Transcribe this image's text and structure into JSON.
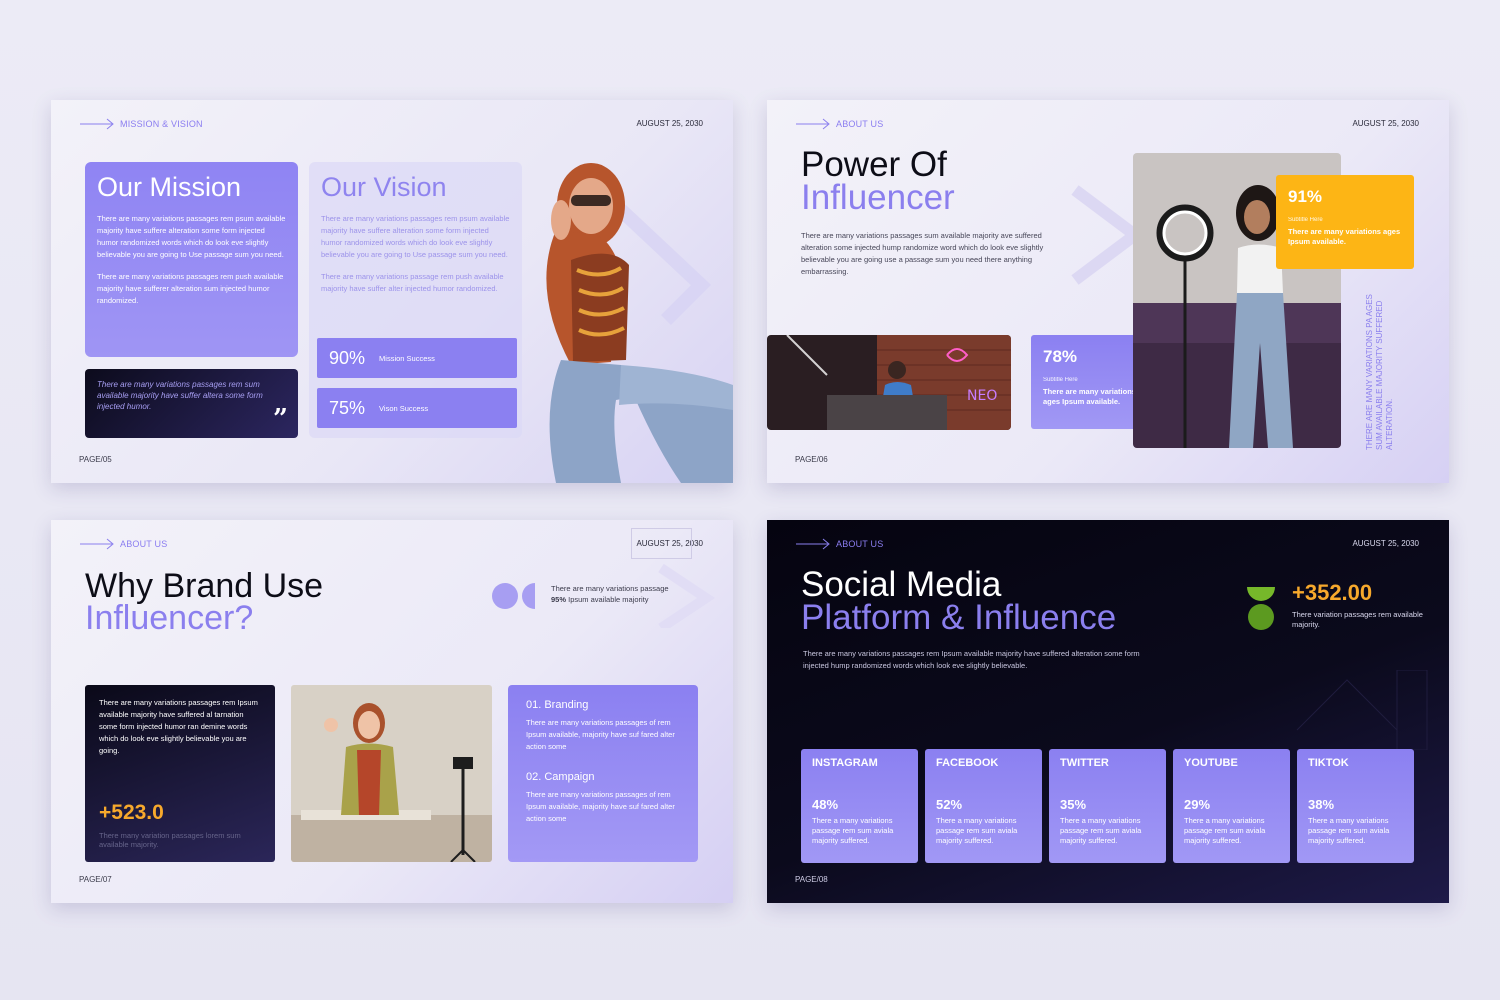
{
  "colors": {
    "accent": "#8b7fee",
    "orange": "#f7a92c",
    "dark": "#0b0a1c",
    "green": "#76b82a"
  },
  "slide1": {
    "tag": "MISSION & VISION",
    "date": "AUGUST 25, 2030",
    "mission_title": "Our Mission",
    "mission_p1": "There are many variations passages rem psum available majority have suffere alteration some form injected humor randomized words which do look eve slightly believable you are going to Use passage sum you need.",
    "mission_p2": "There are many variations passages rem push available majority have sufferer alteration sum injected humor randomized.",
    "vision_title": "Our Vision",
    "vision_p1": "There are many variations passages rem psum available majority have suffere alteration some form injected humor randomized words which do look eve slightly believable you are going to Use passage sum you need.",
    "vision_p2": "There are many variations passage rem push available majority have suffer alter injected humor randomized.",
    "quote": "There are many variations passages rem sum available majority have suffer altera some form injected humor.",
    "stat1_num": "90%",
    "stat1_label": "Mission Success",
    "stat2_num": "75%",
    "stat2_label": "Vison Success",
    "page": "PAGE/05"
  },
  "slide2": {
    "tag": "ABOUT US",
    "date": "AUGUST 25, 2030",
    "title_line1": "Power Of",
    "title_line2": "Influencer",
    "body": "There are many variations passages sum available majority ave suffered alteration some injected hump randomize word which do look eve slightly believable you are going use a passage sum you need there anything embarrassing.",
    "card1_num": "78%",
    "card1_sub": "Subtitle Here",
    "card1_text": "There are many variations ages Ipsum available.",
    "card2_num": "91%",
    "card2_sub": "Subtitle Here",
    "card2_text": "There are many variations ages Ipsum available.",
    "vertical_text": "THERE ARE MANY VARIATIONS PA AGES SUM AVAILABLE MAJORITY SUFFERED ALTERATION.",
    "page": "PAGE/06"
  },
  "slide3": {
    "tag": "ABOUT US",
    "date": "AUGUST 25, 2030",
    "title_line1": "Why Brand Use",
    "title_line2": "Influencer?",
    "dots_line1": "There are many variations passage",
    "dots_pct": "95%",
    "dots_line2": "Ipsum available majority",
    "dark_text": "There are many variations passages rem Ipsum available majority have suffered al tarnation some form injected humor ran demine words which do look eve slightly believable you are going.",
    "dark_num": "+523.0",
    "dark_sub": "There many variation passages lorem sum available majority.",
    "item1_title": "01. Branding",
    "item1_text": "There are many variations passages of rem Ipsum available, majority have suf fared alter action some",
    "item2_title": "02. Campaign",
    "item2_text": "There are many variations passages of rem Ipsum available, majority have suf fared alter action some",
    "page": "PAGE/07"
  },
  "slide4": {
    "tag": "ABOUT US",
    "date": "AUGUST 25, 2030",
    "title_line1": "Social Media",
    "title_line2": "Platform & Influence",
    "body": "There are many variations passages rem Ipsum available majority have suffered alteration some form injected hump randomized words which look eve slightly believable.",
    "stat_num": "+352.00",
    "stat_text": "There variation passages rem available majority.",
    "platforms": [
      {
        "name": "INSTAGRAM",
        "pct": "48%",
        "desc": "There a many variations passage rem sum aviala majority suffered."
      },
      {
        "name": "FACEBOOK",
        "pct": "52%",
        "desc": "There a many variations passage rem sum aviala majority suffered."
      },
      {
        "name": "TWITTER",
        "pct": "35%",
        "desc": "There a many variations passage rem sum aviala majority suffered."
      },
      {
        "name": "YOUTUBE",
        "pct": "29%",
        "desc": "There a many variations passage rem sum aviala majority suffered."
      },
      {
        "name": "TIKTOK",
        "pct": "38%",
        "desc": "There a many variations passage rem sum aviala majority suffered."
      }
    ],
    "page": "PAGE/08"
  }
}
